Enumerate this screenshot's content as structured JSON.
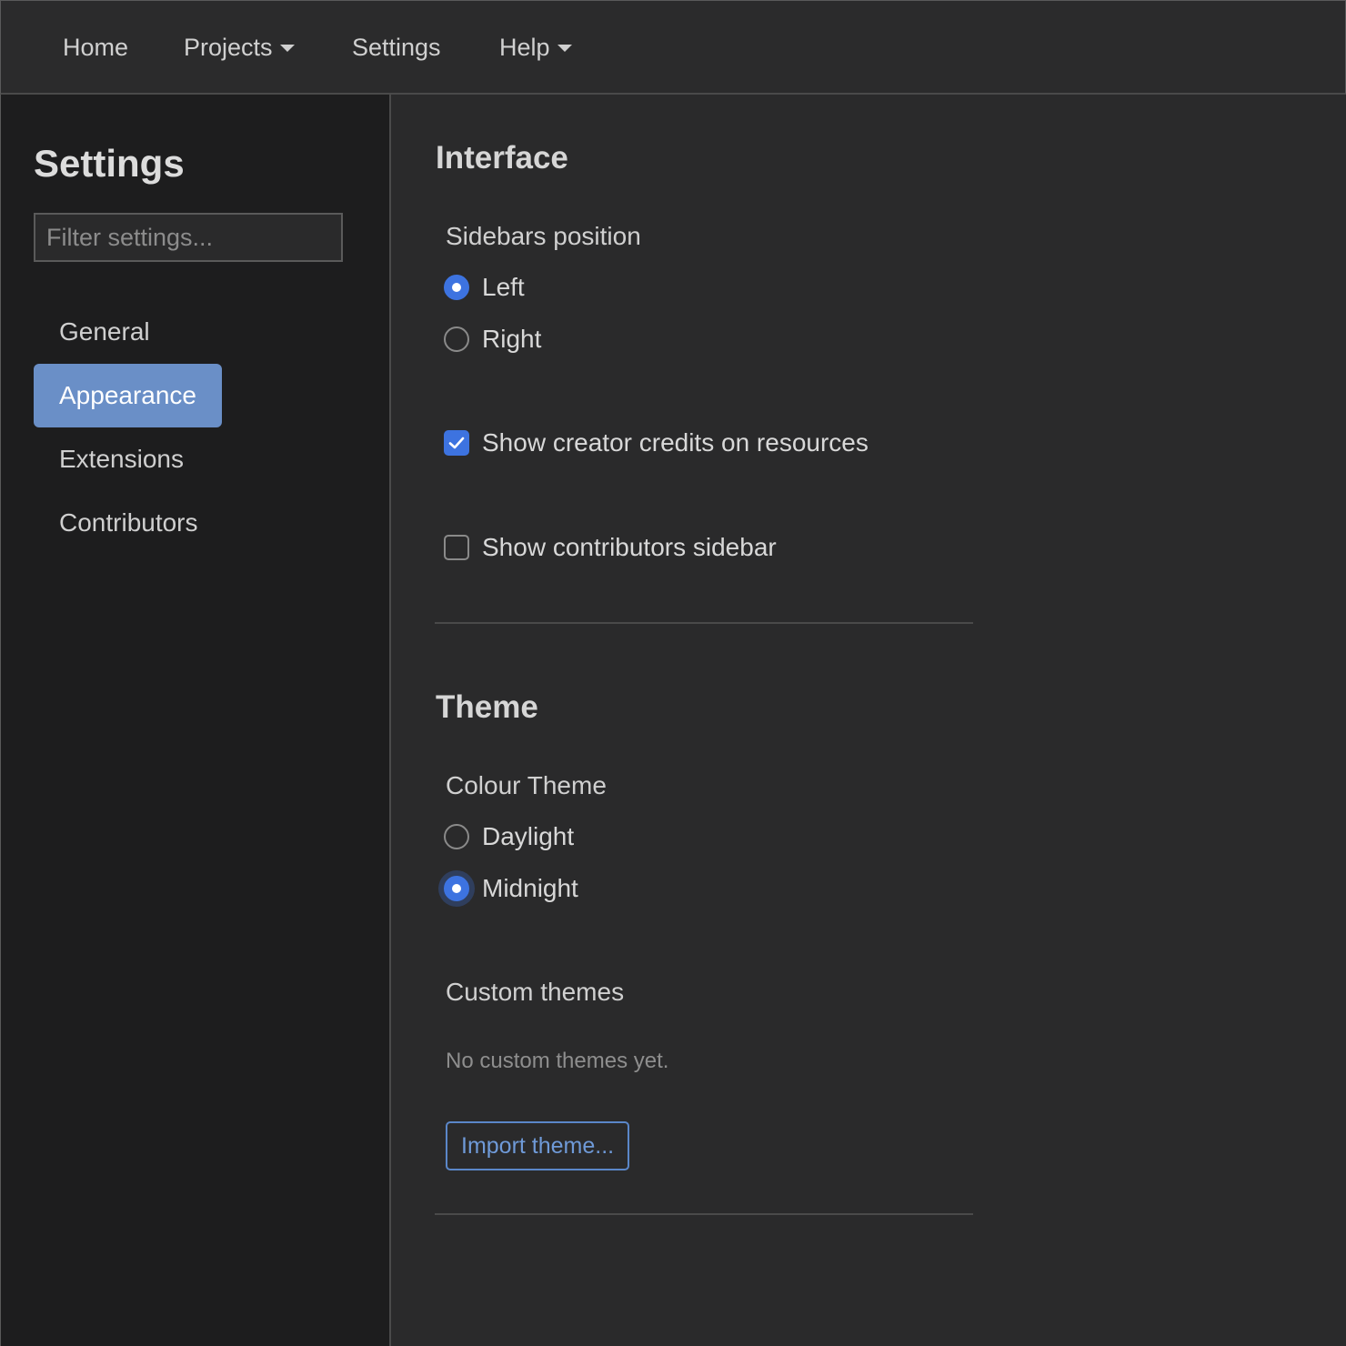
{
  "topnav": {
    "items": [
      {
        "label": "Home",
        "dropdown": false
      },
      {
        "label": "Projects",
        "dropdown": true
      },
      {
        "label": "Settings",
        "dropdown": false
      },
      {
        "label": "Help",
        "dropdown": true
      }
    ]
  },
  "sidebar": {
    "title": "Settings",
    "filter_placeholder": "Filter settings...",
    "filter_value": "",
    "items": [
      {
        "label": "General",
        "active": false
      },
      {
        "label": "Appearance",
        "active": true
      },
      {
        "label": "Extensions",
        "active": false
      },
      {
        "label": "Contributors",
        "active": false
      }
    ]
  },
  "interface": {
    "title": "Interface",
    "sidebars_position": {
      "label": "Sidebars position",
      "options": [
        "Left",
        "Right"
      ],
      "selected": "Left"
    },
    "show_creator_credits": {
      "label": "Show creator credits on resources",
      "checked": true
    },
    "show_contributors_sidebar": {
      "label": "Show contributors sidebar",
      "checked": false
    }
  },
  "theme": {
    "title": "Theme",
    "colour_theme": {
      "label": "Colour Theme",
      "options": [
        "Daylight",
        "Midnight"
      ],
      "selected": "Midnight"
    },
    "custom_themes": {
      "label": "Custom themes",
      "empty_text": "No custom themes yet.",
      "import_label": "Import theme..."
    }
  },
  "colors": {
    "accent": "#3d73e0",
    "active_nav": "#6a8fc7",
    "link_button": "#6f9ad8",
    "background": "#2a2a2b",
    "sidebar_background": "#1d1d1e"
  }
}
